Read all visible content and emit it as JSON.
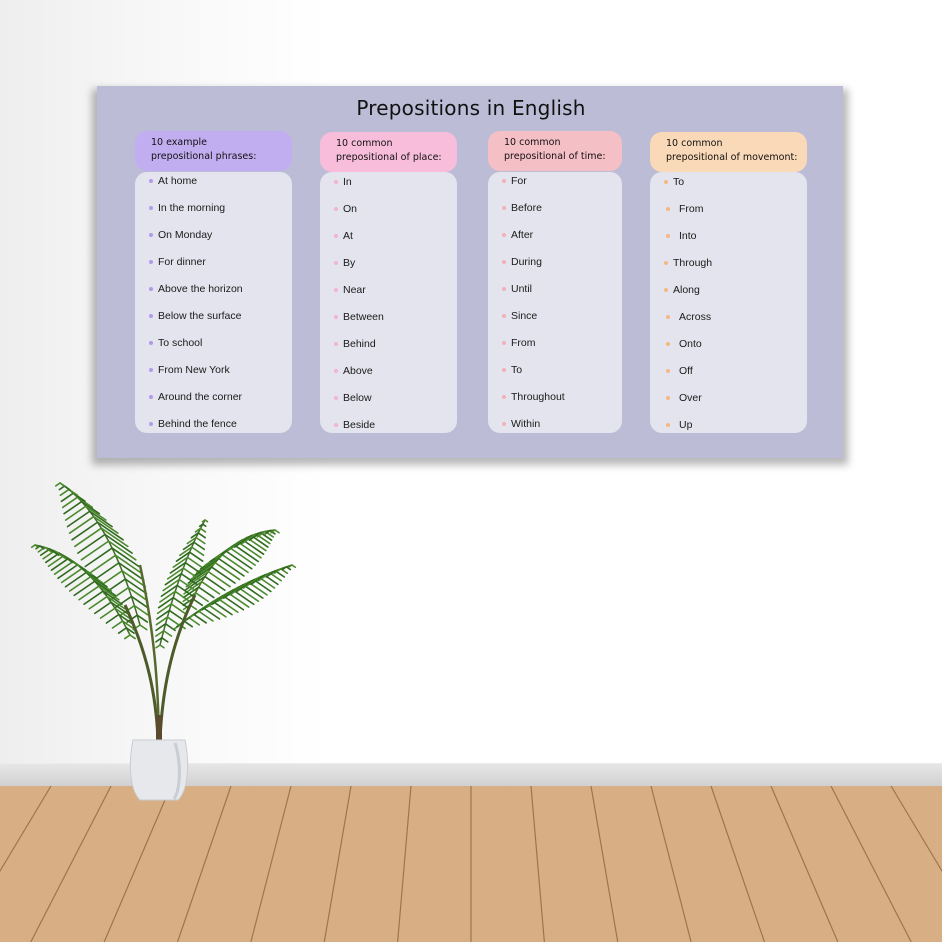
{
  "poster": {
    "title": "Prepositions in English",
    "background_color": "#bcbcd6",
    "columns": [
      {
        "header_line1": "10 example",
        "header_line2": "prepositional phrases:",
        "header_color": "#c1aef0",
        "bullet_color": "#b29ae8",
        "items": [
          "At home",
          "In the morning",
          "On Monday",
          "For dinner",
          "Above the horizon",
          "Below the surface",
          "To school",
          "From New York",
          "Around the corner",
          "Behind the fence"
        ]
      },
      {
        "header_line1": "10 common",
        "header_line2": "prepositional of place:",
        "header_color": "#f7bddb",
        "bullet_color": "#f3b3d2",
        "items": [
          "In",
          "On",
          "At",
          "By",
          "Near",
          "Between",
          "Behind",
          "Above",
          "Below",
          "Beside"
        ]
      },
      {
        "header_line1": "10 common",
        "header_line2": "prepositional of time:",
        "header_color": "#f5bfc6",
        "bullet_color": "#f0b1b8",
        "items": [
          "For",
          "Before",
          "After",
          "During",
          "Until",
          "Since",
          "From",
          "To",
          "Throughout",
          "Within"
        ]
      },
      {
        "header_line1": "10 common",
        "header_line2": "prepositional of movemont:",
        "header_color": "#fad9b8",
        "bullet_color": "#f5b87e",
        "items": [
          "To",
          "From",
          "Into",
          "Through",
          "Along",
          "Across",
          "Onto",
          "Off",
          "Over",
          "Up"
        ]
      }
    ]
  },
  "scene": {
    "wall_color": "#ffffff",
    "floor_color": "#d8af85",
    "baseboard_color": "#d9d9d9",
    "objects": [
      "potted-palm-plant",
      "white-vase"
    ]
  }
}
